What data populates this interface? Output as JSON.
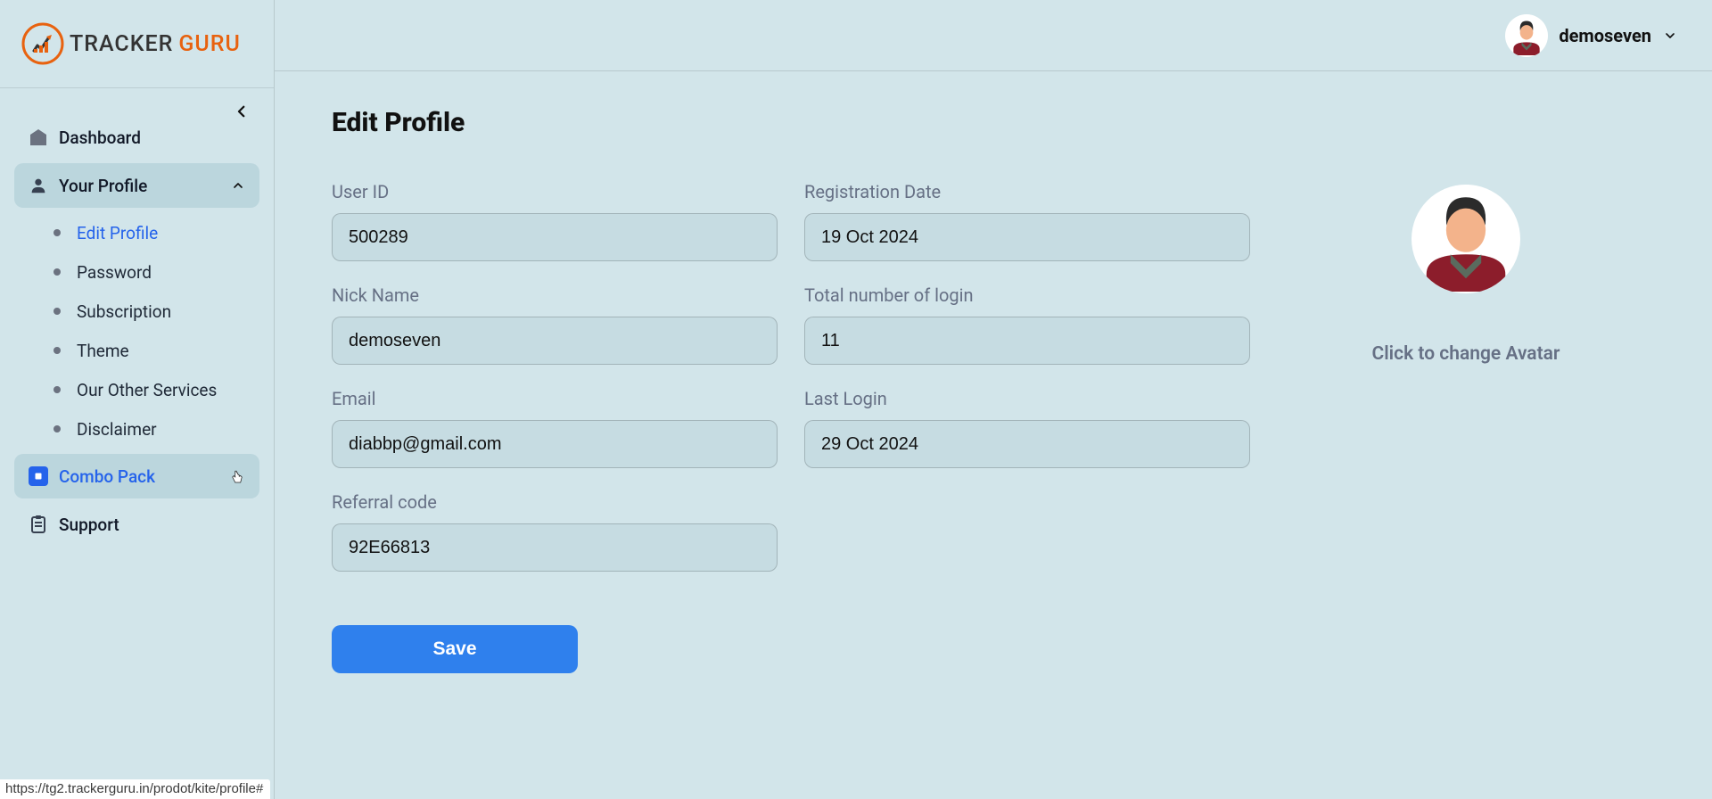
{
  "brand": {
    "name_part1": "TRACKER",
    "name_part2": "GURU"
  },
  "header": {
    "username": "demoseven"
  },
  "sidebar": {
    "items": {
      "dashboard": "Dashboard",
      "profile": "Your Profile",
      "combo": "Combo Pack",
      "support": "Support"
    },
    "profile_sub": [
      "Edit Profile",
      "Password",
      "Subscription",
      "Theme",
      "Our Other Services",
      "Disclaimer"
    ]
  },
  "page": {
    "title": "Edit Profile"
  },
  "form": {
    "labels": {
      "user_id": "User ID",
      "reg_date": "Registration Date",
      "nick": "Nick Name",
      "login_count": "Total number of login",
      "email": "Email",
      "last_login": "Last Login",
      "referral": "Referral code"
    },
    "values": {
      "user_id": "500289",
      "reg_date": "19 Oct 2024",
      "nick": "demoseven",
      "login_count": "11",
      "email": "diabbp@gmail.com",
      "last_login": "29 Oct 2024",
      "referral": "92E66813"
    },
    "save_label": "Save"
  },
  "avatar": {
    "change_label": "Click to change Avatar"
  },
  "status_url": "https://tg2.trackerguru.in/prodot/kite/profile#"
}
